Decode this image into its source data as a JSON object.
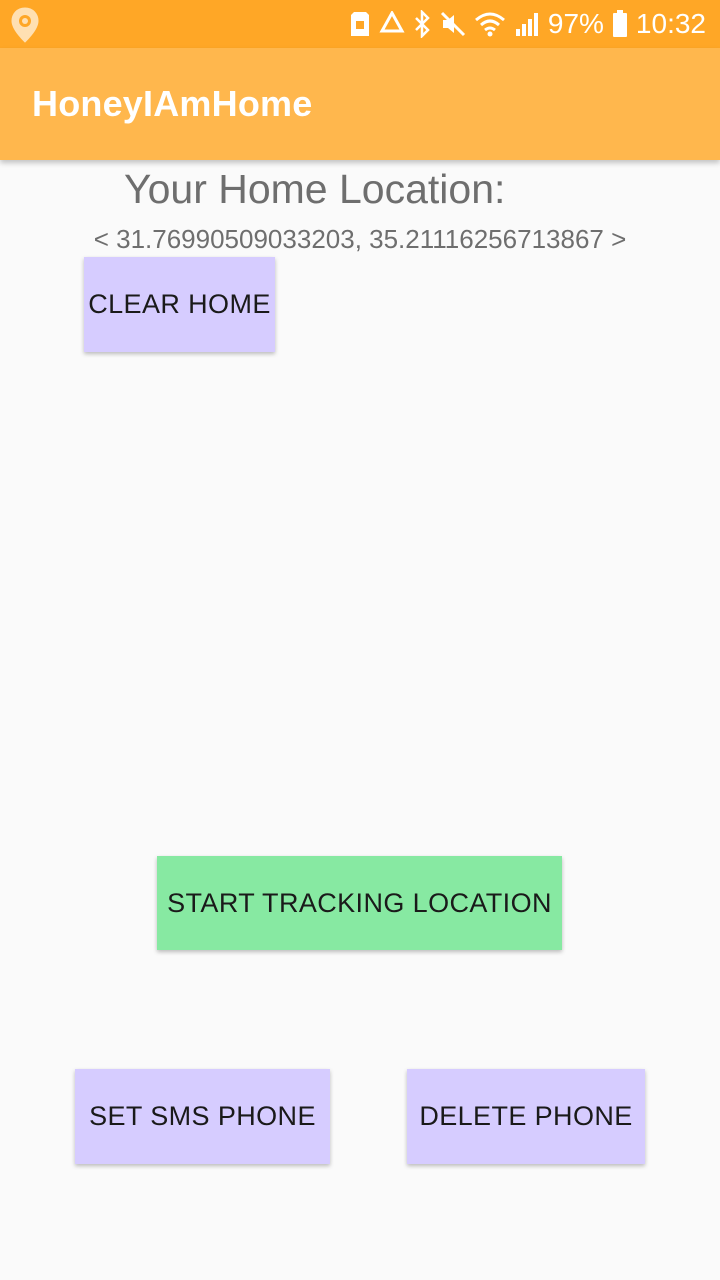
{
  "status_bar": {
    "battery_percent": "97%",
    "time": "10:32",
    "icons": [
      "location-pin-icon",
      "sd-card-icon",
      "recycle-icon",
      "bluetooth-icon",
      "mute-icon",
      "wifi-icon",
      "signal-icon",
      "battery-icon"
    ]
  },
  "app_bar": {
    "title": "HoneyIAmHome"
  },
  "home": {
    "label": "Your Home Location:",
    "coordinates": "< 31.76990509033203, 35.21116256713867 >"
  },
  "buttons": {
    "clear_home": "CLEAR HOME",
    "start_tracking": "START TRACKING LOCATION",
    "set_sms_phone": "SET SMS PHONE",
    "delete_phone": "DELETE PHONE"
  },
  "colors": {
    "status_bar": "#ffa726",
    "app_bar": "#ffb74d",
    "button_lavender": "#d6ccff",
    "button_green": "#87e9a2",
    "background": "#fafafa"
  }
}
